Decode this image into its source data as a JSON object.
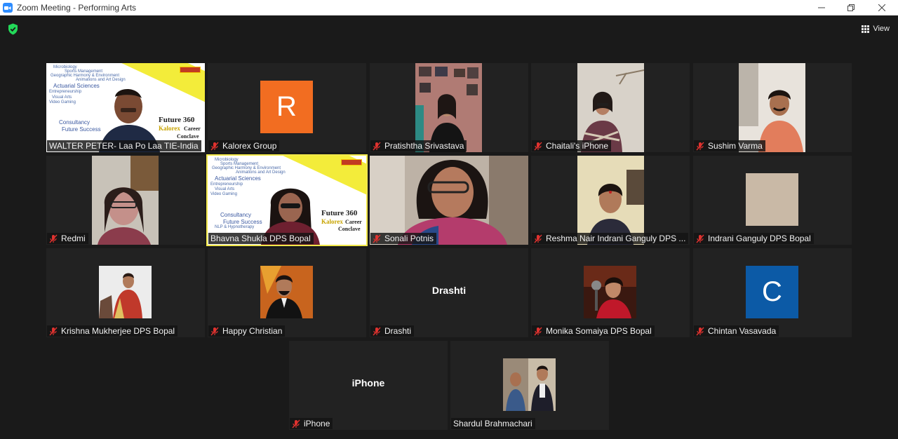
{
  "window": {
    "title": "Zoom Meeting - Performing Arts",
    "controls": [
      "minimize",
      "restore",
      "close"
    ]
  },
  "toolbar": {
    "view_label": "View"
  },
  "colors": {
    "background": "#1a1a1a",
    "tile": "#222222",
    "active_speaker": "#f2e84a",
    "mute_icon": "#e0322f",
    "security_shield": "#23d959"
  },
  "participants": [
    {
      "name": "WALTER PETER- Laa Po Laa TIE-India",
      "muted": false,
      "video": "slide"
    },
    {
      "name": "Kalorex Group",
      "muted": true,
      "avatar_letter": "R",
      "avatar_color": "#f26d21"
    },
    {
      "name": "Pratishtha Srivastava",
      "muted": true,
      "video": "camera"
    },
    {
      "name": "Chaitali's iPhone",
      "muted": true,
      "video": "camera"
    },
    {
      "name": "Sushim Varma",
      "muted": true,
      "video": "camera"
    },
    {
      "name": "Redmi",
      "muted": true,
      "video": "camera"
    },
    {
      "name": "Bhavna Shukla DPS Bopal",
      "muted": false,
      "video": "slide",
      "active": true
    },
    {
      "name": "Sonali Potnis",
      "muted": true,
      "video": "camera"
    },
    {
      "name": "Reshma Nair Indrani Ganguly DPS ...",
      "muted": true,
      "video": "camera"
    },
    {
      "name": "Indrani Ganguly DPS Bopal",
      "muted": true,
      "video": "camera"
    },
    {
      "name": "Krishna Mukherjee DPS Bopal",
      "muted": true,
      "video": "photo"
    },
    {
      "name": "Happy Christian",
      "muted": true,
      "video": "photo"
    },
    {
      "name": "Drashti",
      "muted": true,
      "display_name": "Drashti"
    },
    {
      "name": "Monika Somaiya DPS Bopal",
      "muted": true,
      "video": "photo"
    },
    {
      "name": "Chintan Vasavada",
      "muted": true,
      "avatar_letter": "C",
      "avatar_color": "#0c5aa6"
    },
    {
      "name": "iPhone",
      "muted": true,
      "display_name": "iPhone"
    },
    {
      "name": "Shardul Brahmachari",
      "muted": false,
      "video": "photo"
    }
  ],
  "slide": {
    "words": [
      "Microbiology",
      "Sports Management",
      "Geographic Harmony & Environment",
      "Animations and Art Design",
      "Actuarial Sciences",
      "Entrepreneurship",
      "Visual Arts",
      "Video Gaming",
      "Consultancy",
      "Future Success",
      "NLP & Hypnotherapy"
    ],
    "title": "Future 360",
    "brand": "Kalorex",
    "career": "Career",
    "conclave": "Conclave"
  }
}
